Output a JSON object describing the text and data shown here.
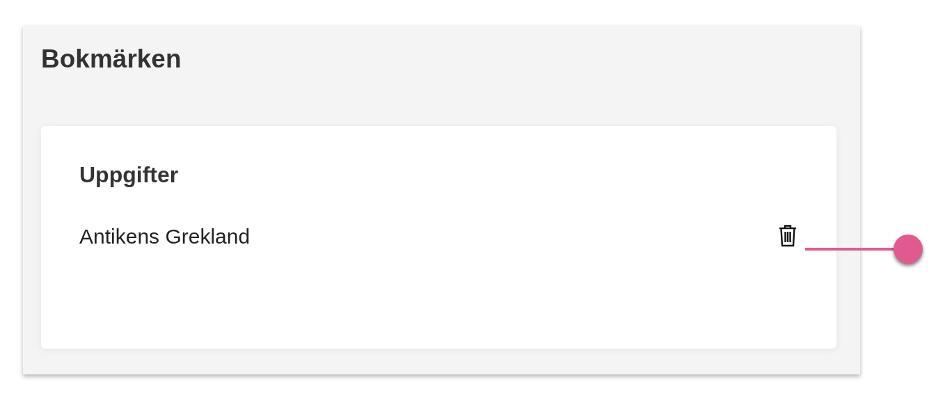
{
  "panel": {
    "title": "Bokmärken"
  },
  "section": {
    "title": "Uppgifter",
    "items": [
      {
        "label": "Antikens Grekland"
      }
    ]
  }
}
